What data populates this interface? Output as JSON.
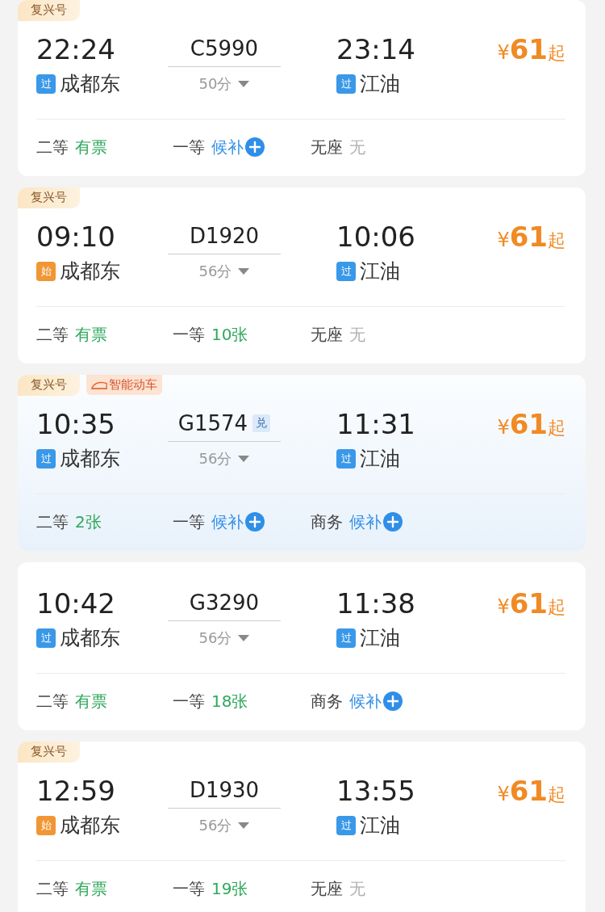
{
  "trains": [
    {
      "highlighted": false,
      "tags": [
        {
          "kind": "plain",
          "label": "复兴号"
        }
      ],
      "depart_time": "22:24",
      "train_number": "C5990",
      "arrive_time": "23:14",
      "from": {
        "kind": "pass",
        "badge": "过",
        "name": "成都东"
      },
      "duration": "50分",
      "to": {
        "kind": "pass",
        "badge": "过",
        "name": "江油"
      },
      "price": {
        "currency": "¥",
        "amount": "61",
        "suffix": "起"
      },
      "seats": [
        {
          "class": "二等",
          "kind": "available",
          "value": "有票"
        },
        {
          "class": "一等",
          "kind": "waitlist",
          "value": "候补"
        },
        {
          "class": "无座",
          "kind": "none",
          "value": "无"
        }
      ]
    },
    {
      "highlighted": false,
      "tags": [
        {
          "kind": "plain",
          "label": "复兴号"
        }
      ],
      "depart_time": "09:10",
      "train_number": "D1920",
      "arrive_time": "10:06",
      "from": {
        "kind": "start",
        "badge": "始",
        "name": "成都东"
      },
      "duration": "56分",
      "to": {
        "kind": "pass",
        "badge": "过",
        "name": "江油"
      },
      "price": {
        "currency": "¥",
        "amount": "61",
        "suffix": "起"
      },
      "seats": [
        {
          "class": "二等",
          "kind": "available",
          "value": "有票"
        },
        {
          "class": "一等",
          "kind": "available",
          "value": "10张"
        },
        {
          "class": "无座",
          "kind": "none",
          "value": "无"
        }
      ]
    },
    {
      "highlighted": true,
      "tags": [
        {
          "kind": "plain",
          "label": "复兴号"
        },
        {
          "kind": "smart",
          "label": "智能动车"
        }
      ],
      "depart_time": "10:35",
      "train_number": "G1574",
      "train_badge": "兑",
      "arrive_time": "11:31",
      "from": {
        "kind": "pass",
        "badge": "过",
        "name": "成都东"
      },
      "duration": "56分",
      "to": {
        "kind": "pass",
        "badge": "过",
        "name": "江油"
      },
      "price": {
        "currency": "¥",
        "amount": "61",
        "suffix": "起"
      },
      "seats": [
        {
          "class": "二等",
          "kind": "available",
          "value": "2张"
        },
        {
          "class": "一等",
          "kind": "waitlist",
          "value": "候补"
        },
        {
          "class": "商务",
          "kind": "waitlist",
          "value": "候补"
        }
      ]
    },
    {
      "highlighted": false,
      "depart_time": "10:42",
      "train_number": "G3290",
      "arrive_time": "11:38",
      "from": {
        "kind": "pass",
        "badge": "过",
        "name": "成都东"
      },
      "duration": "56分",
      "to": {
        "kind": "pass",
        "badge": "过",
        "name": "江油"
      },
      "price": {
        "currency": "¥",
        "amount": "61",
        "suffix": "起"
      },
      "seats": [
        {
          "class": "二等",
          "kind": "available",
          "value": "有票"
        },
        {
          "class": "一等",
          "kind": "available",
          "value": "18张"
        },
        {
          "class": "商务",
          "kind": "waitlist",
          "value": "候补"
        }
      ]
    },
    {
      "highlighted": false,
      "tags": [
        {
          "kind": "plain",
          "label": "复兴号"
        }
      ],
      "depart_time": "12:59",
      "train_number": "D1930",
      "arrive_time": "13:55",
      "from": {
        "kind": "start",
        "badge": "始",
        "name": "成都东"
      },
      "duration": "56分",
      "to": {
        "kind": "pass",
        "badge": "过",
        "name": "江油"
      },
      "price": {
        "currency": "¥",
        "amount": "61",
        "suffix": "起"
      },
      "seats": [
        {
          "class": "二等",
          "kind": "available",
          "value": "有票"
        },
        {
          "class": "一等",
          "kind": "available",
          "value": "19张"
        },
        {
          "class": "无座",
          "kind": "none",
          "value": "无"
        }
      ]
    }
  ]
}
